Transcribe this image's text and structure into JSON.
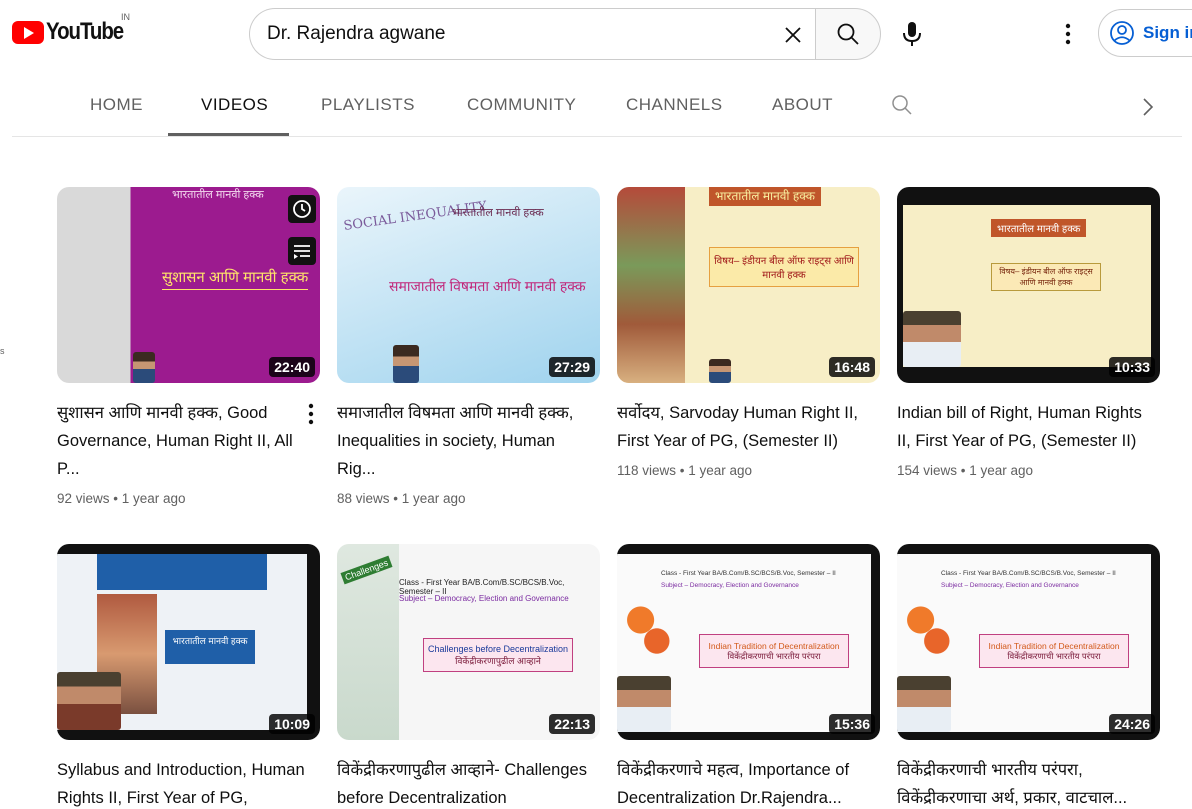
{
  "masthead": {
    "logo_text": "YouTube",
    "country_code": "IN",
    "search_value": "Dr. Rajendra agwane",
    "sign_in_label": "Sign in",
    "icons": [
      "youtube-logo",
      "close-icon",
      "search-icon",
      "mic-icon",
      "more-vert-icon",
      "account-circle-icon"
    ]
  },
  "tabs": [
    {
      "label": "HOME"
    },
    {
      "label": "VIDEOS"
    },
    {
      "label": "PLAYLISTS"
    },
    {
      "label": "COMMUNITY"
    },
    {
      "label": "CHANNELS"
    },
    {
      "label": "ABOUT"
    }
  ],
  "active_tab": "VIDEOS",
  "side_mark": "s",
  "videos": [
    {
      "duration": "22:40",
      "title": "सुशासन आणि मानवी हक्क, Good Governance, Human Right II, All P...",
      "meta": "92 views • 1 year ago",
      "thumb_header": "भारतातील मानवी हक्क",
      "thumb_caption": "सुशासन आणि मानवी हक्क"
    },
    {
      "duration": "27:29",
      "title": "समाजातील विषमता आणि मानवी हक्क, Inequalities in society, Human Rig...",
      "meta": "88 views • 1 year ago",
      "thumb_header": "भारतातील मानवी हक्क",
      "thumb_caption": "समाजातील विषमता आणि मानवी हक्क",
      "thumb_word": "SOCIAL INEQUALITY"
    },
    {
      "duration": "16:48",
      "title": "सर्वोदय, Sarvoday Human Right II, First Year of PG, (Semester II)",
      "meta": "118 views • 1 year ago",
      "thumb_header": "भारतातील मानवी हक्क",
      "thumb_caption": "विषय– इंडीयन बील ऑफ राइट्स आणि मानवी हक्क"
    },
    {
      "duration": "10:33",
      "title": "Indian bill of Right, Human Rights II, First Year of PG, (Semester II)",
      "meta": "154 views • 1 year ago",
      "thumb_header": "भारतातील मानवी हक्क",
      "thumb_caption": "विषय– इंडीयन बील ऑफ राइट्स आणि मानवी हक्क"
    },
    {
      "duration": "10:09",
      "title": "Syllabus and Introduction, Human Rights II, First Year of PG, (Semest...",
      "meta": "",
      "thumb_caption": "भारतातील मानवी हक्क"
    },
    {
      "duration": "22:13",
      "title": "विकेंद्रीकरणापुढील आव्हाने- Challenges before Decentralization",
      "meta": "",
      "thumb_header": "Class - First Year BA/B.Com/B.SC/BCS/B.Voc, Semester – II",
      "thumb_sub": "Subject – Democracy, Election and Governance",
      "thumb_caption": "Challenges before Decentralization",
      "thumb_caption2": "विकेंद्रीकरणापुढील आव्हाने",
      "thumb_word": "Challenges"
    },
    {
      "duration": "15:36",
      "title": "विकेंद्रीकरणाचे महत्व, Importance of Decentralization Dr.Rajendra...",
      "meta": "",
      "thumb_header": "Class - First Year BA/B.Com/B.SC/BCS/B.Voc, Semester – II",
      "thumb_sub": "Subject – Democracy, Election and Governance",
      "thumb_caption": "Indian Tradition of Decentralization",
      "thumb_caption2": "विकेंद्रीकरणाची भारतीय परंपरा"
    },
    {
      "duration": "24:26",
      "title": "विकेंद्रीकरणाची भारतीय परंपरा, विकेंद्रीकरणाचा अर्थ, प्रकार, वाटचाल...",
      "meta": "",
      "thumb_header": "Class - First Year BA/B.Com/B.SC/BCS/B.Voc, Semester – II",
      "thumb_sub": "Subject – Democracy, Election and Governance",
      "thumb_caption": "Indian Tradition of Decentralization",
      "thumb_caption2": "विकेंद्रीकरणाची भारतीय परंपरा"
    }
  ],
  "colors": {
    "brand_red": "#ff0000",
    "link_blue": "#065fd4",
    "text_primary": "#0f0f0f",
    "text_secondary": "#606060"
  }
}
